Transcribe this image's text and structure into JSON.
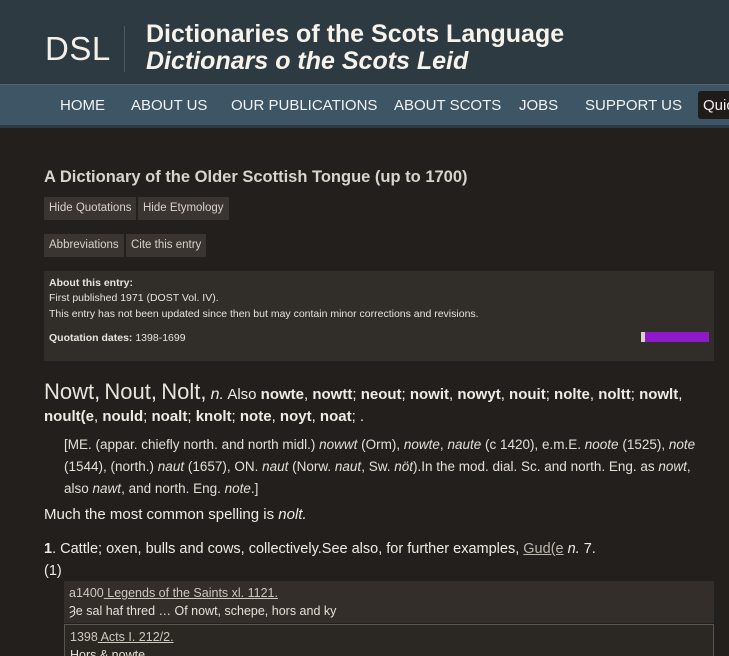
{
  "header": {
    "logo": "DSL",
    "title": "Dictionaries of the Scots Language",
    "subtitle": "Dictionars o the Scots Leid"
  },
  "nav": {
    "items": [
      "HOME",
      "ABOUT US",
      "OUR PUBLICATIONS",
      "ABOUT SCOTS",
      "JOBS",
      "SUPPORT US"
    ],
    "quick_search": "Quick"
  },
  "entry": {
    "dictionary_title": "A Dictionary of the Older Scottish Tongue (up to 1700)",
    "buttons": {
      "hide_quotations": "Hide Quotations",
      "hide_etymology": "Hide Etymology",
      "abbreviations": "Abbreviations",
      "cite": "Cite this entry"
    },
    "about": {
      "heading": "About this entry:",
      "published": "First published 1971 (DOST Vol. IV).",
      "updated": "This entry has not been updated since then but may contain minor corrections and revisions.",
      "quotation_dates_label": "Quotation dates:",
      "quotation_dates": "1398-1699",
      "timeline_fill": 1.0,
      "timeline_color": "#8f19c9"
    },
    "headwords": [
      "Nowt",
      "Nout",
      "Nolt"
    ],
    "part_of_speech": "n.",
    "also_label": "Also",
    "variants": [
      "nowte",
      "nowtt",
      "neout",
      "nowit",
      "nowyt",
      "nouit",
      "nolte",
      "noltt",
      "nowlt",
      "noult(e",
      "nould",
      "noalt",
      "knolt",
      "note",
      "noyt",
      "noat"
    ],
    "etymology": {
      "p1": "[ME. (appar. chiefly north. and north midl.) ",
      "w1": "nowwt",
      "p2": " (Orm), ",
      "w2": "nowte",
      "p3": ", ",
      "w3": "naute",
      "p4": " (c 1420), e.m.E. ",
      "w4": "noote",
      "p5": " (1525), ",
      "w5": "note",
      "p6": " (1544), (north.) ",
      "w6": "naut",
      "p7": " (1657), ON. ",
      "w7": "naut",
      "p8": " (Norw. ",
      "w8": "naut",
      "p9": ", Sw. ",
      "w9": "nöt",
      "p10": ").In the mod. dial. Sc. and north. Eng. as ",
      "w10": "nowt",
      "p11": ", also ",
      "w11": "nawt",
      "p12": ", and north. Eng. ",
      "w12": "note",
      "p13": ".]"
    },
    "common_spelling_text": "Much the most common spelling is ",
    "common_spelling_word": "nolt.",
    "sense": {
      "number": "1",
      "text": ". Cattle; oxen, bulls and cows, collectively.See also, for further examples, ",
      "xref": "Gud(e",
      "xref_pos": "n.",
      "xref_num": " 7.",
      "subsense": "(1)"
    },
    "quotations": [
      {
        "date": "a1400",
        "source": " Legends of the Saints xl. 1121.",
        "text": "Ȝe sal haf thred … Of nowt, schepe, hors and ky"
      },
      {
        "date": "1398",
        "source": " Acts I. 212/2.",
        "text": "Hors & nowte"
      }
    ]
  }
}
